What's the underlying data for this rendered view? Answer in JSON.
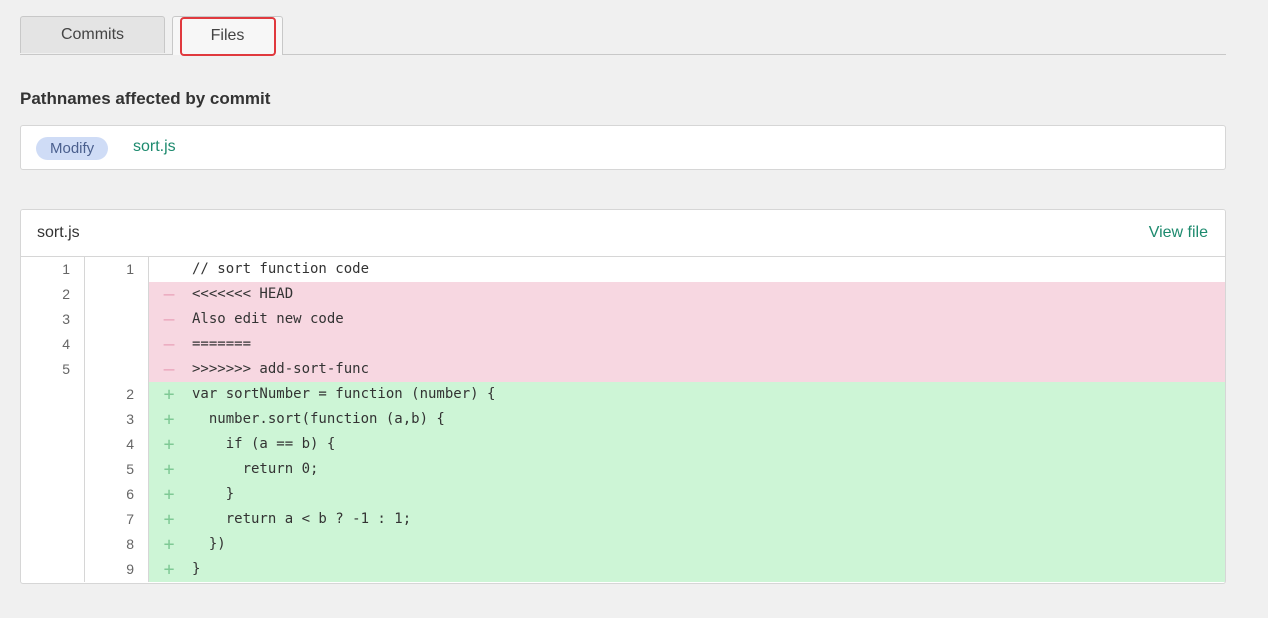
{
  "tabs": {
    "commits_label": "Commits",
    "files_label": "Files"
  },
  "section": {
    "title": "Pathnames affected by commit"
  },
  "paths": [
    {
      "badge": "Modify",
      "name": "sort.js"
    }
  ],
  "file": {
    "name": "sort.js",
    "view_label": "View file",
    "lines": [
      {
        "old": "1",
        "new": "1",
        "type": "context",
        "sign": "",
        "code": "// sort function code"
      },
      {
        "old": "2",
        "new": "",
        "type": "del",
        "sign": "—",
        "code": "<<<<<<< HEAD"
      },
      {
        "old": "3",
        "new": "",
        "type": "del",
        "sign": "—",
        "code": "Also edit new code"
      },
      {
        "old": "4",
        "new": "",
        "type": "del",
        "sign": "—",
        "code": "======="
      },
      {
        "old": "5",
        "new": "",
        "type": "del",
        "sign": "—",
        "code": ">>>>>>> add-sort-func"
      },
      {
        "old": "",
        "new": "2",
        "type": "add",
        "sign": "+",
        "code": "var sortNumber = function (number) {"
      },
      {
        "old": "",
        "new": "3",
        "type": "add",
        "sign": "+",
        "code": "  number.sort(function (a,b) {"
      },
      {
        "old": "",
        "new": "4",
        "type": "add",
        "sign": "+",
        "code": "    if (a == b) {"
      },
      {
        "old": "",
        "new": "5",
        "type": "add",
        "sign": "+",
        "code": "      return 0;"
      },
      {
        "old": "",
        "new": "6",
        "type": "add",
        "sign": "+",
        "code": "    }"
      },
      {
        "old": "",
        "new": "7",
        "type": "add",
        "sign": "+",
        "code": "    return a < b ? -1 : 1;"
      },
      {
        "old": "",
        "new": "8",
        "type": "add",
        "sign": "+",
        "code": "  })"
      },
      {
        "old": "",
        "new": "9",
        "type": "add",
        "sign": "+",
        "code": "}"
      }
    ]
  },
  "colors": {
    "accent": "#1d8a6e",
    "highlight": "#e0393e",
    "deleted_bg": "#f7d7e1",
    "added_bg": "#cdf5d6",
    "badge_bg": "#cfdcf6"
  }
}
